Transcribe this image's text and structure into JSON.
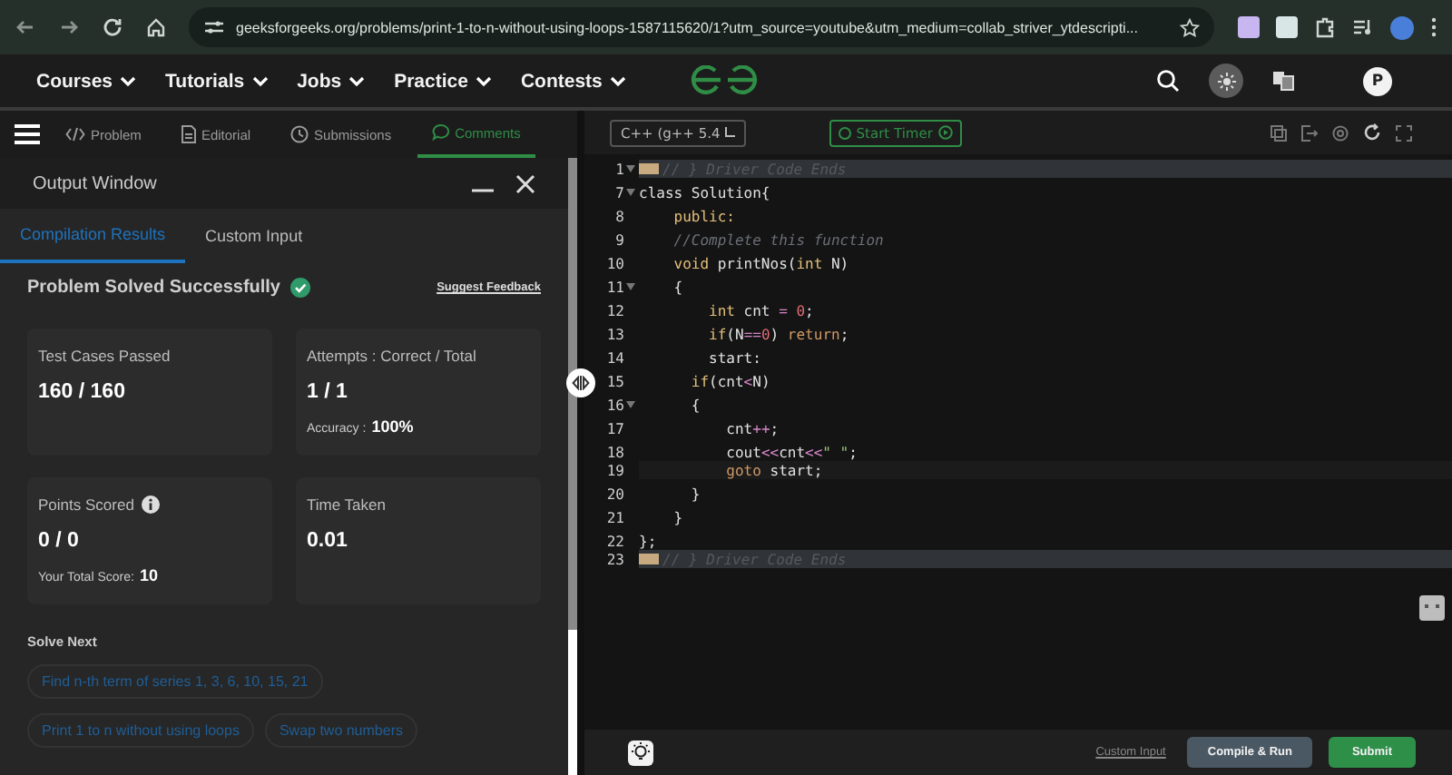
{
  "browser": {
    "url": "geeksforgeeks.org/problems/print-1-to-n-without-using-loops-1587115620/1?utm_source=youtube&utm_medium=collab_striver_ytdescripti..."
  },
  "nav": {
    "items": [
      "Courses",
      "Tutorials",
      "Jobs",
      "Practice",
      "Contests"
    ],
    "profile": "P"
  },
  "tabs": [
    {
      "label": "Problem",
      "selected": false
    },
    {
      "label": "Editorial",
      "selected": false
    },
    {
      "label": "Submissions",
      "selected": false
    },
    {
      "label": "Comments",
      "selected": true
    }
  ],
  "output": {
    "title": "Output Window",
    "tabs": [
      {
        "label": "Compilation Results",
        "selected": true
      },
      {
        "label": "Custom Input",
        "selected": false
      }
    ],
    "status": "Problem Solved Successfully",
    "feedback": "Suggest Feedback",
    "cards": [
      {
        "label": "Test Cases Passed",
        "value": "160 / 160"
      },
      {
        "label": "Attempts : Correct / Total",
        "value": "1 / 1",
        "sub_label": "Accuracy :",
        "sub_value": "100%"
      },
      {
        "label": "Points Scored",
        "value": "0 / 0",
        "info": true,
        "sub_label": "Your Total Score:",
        "sub_value": "10"
      },
      {
        "label": "Time Taken",
        "value": "0.01"
      }
    ],
    "solve_next_title": "Solve Next",
    "solve_next": [
      [
        "Find n-th term of series 1, 3, 6, 10, 15, 21"
      ],
      [
        "Print 1 to n without using loops",
        "Swap two numbers"
      ]
    ]
  },
  "editor": {
    "language": "C++ (g++ 5.4",
    "timer": "Start Timer",
    "lines": [
      {
        "n": "1",
        "fold": true,
        "kind": "folded",
        "tokens": [
          {
            "t": "// } Driver Code Ends",
            "kind": "cm"
          }
        ]
      },
      {
        "n": "7",
        "fold": true,
        "kind": "code",
        "tokens": [
          {
            "t": "class Solution{",
            "kind": "pl"
          }
        ]
      },
      {
        "n": "8",
        "fold": false,
        "kind": "code",
        "tokens": [
          {
            "t": "    public:",
            "kind": "kw"
          }
        ]
      },
      {
        "n": "9",
        "fold": false,
        "kind": "code",
        "tokens": [
          {
            "t": "    //Complete this function",
            "kind": "cm"
          }
        ]
      },
      {
        "n": "10",
        "fold": false,
        "kind": "code",
        "tokens": [
          {
            "t": "    void",
            "kind": "kw"
          },
          {
            "t": " printNos(",
            "kind": "pl"
          },
          {
            "t": "int",
            "kind": "kw"
          },
          {
            "t": " N)",
            "kind": "pl"
          }
        ]
      },
      {
        "n": "11",
        "fold": true,
        "kind": "code",
        "tokens": [
          {
            "t": "    {",
            "kind": "pl"
          }
        ]
      },
      {
        "n": "12",
        "fold": false,
        "kind": "code",
        "tokens": [
          {
            "t": "        int",
            "kind": "kw"
          },
          {
            "t": " cnt ",
            "kind": "pl"
          },
          {
            "t": "=",
            "kind": "op"
          },
          {
            "t": " 0",
            "kind": "num"
          },
          {
            "t": ";",
            "kind": "pl"
          }
        ]
      },
      {
        "n": "13",
        "fold": false,
        "kind": "code",
        "tokens": [
          {
            "t": "        if",
            "kind": "kw"
          },
          {
            "t": "(N",
            "kind": "pl"
          },
          {
            "t": "==",
            "kind": "op"
          },
          {
            "t": "0",
            "kind": "num"
          },
          {
            "t": ") ",
            "kind": "pl"
          },
          {
            "t": "return",
            "kind": "ctl"
          },
          {
            "t": ";",
            "kind": "pl"
          }
        ]
      },
      {
        "n": "14",
        "fold": false,
        "kind": "code",
        "tokens": [
          {
            "t": "        start:",
            "kind": "pl"
          }
        ]
      },
      {
        "n": "15",
        "fold": false,
        "kind": "code",
        "tokens": [
          {
            "t": "      if",
            "kind": "kw"
          },
          {
            "t": "(cnt",
            "kind": "pl"
          },
          {
            "t": "<",
            "kind": "op"
          },
          {
            "t": "N)",
            "kind": "pl"
          }
        ]
      },
      {
        "n": "16",
        "fold": true,
        "kind": "code",
        "tokens": [
          {
            "t": "      {",
            "kind": "pl"
          }
        ]
      },
      {
        "n": "17",
        "fold": false,
        "kind": "code",
        "tokens": [
          {
            "t": "          cnt",
            "kind": "pl"
          },
          {
            "t": "++",
            "kind": "op"
          },
          {
            "t": ";",
            "kind": "pl"
          }
        ]
      },
      {
        "n": "18",
        "fold": false,
        "kind": "code",
        "tokens": [
          {
            "t": "          cout",
            "kind": "pl"
          },
          {
            "t": "<<",
            "kind": "op"
          },
          {
            "t": "cnt",
            "kind": "pl"
          },
          {
            "t": "<<",
            "kind": "op"
          },
          {
            "t": "\" \"",
            "kind": "str"
          },
          {
            "t": ";",
            "kind": "pl"
          }
        ]
      },
      {
        "n": "19",
        "fold": false,
        "kind": "current",
        "tokens": [
          {
            "t": "          goto",
            "kind": "ctl"
          },
          {
            "t": " start;",
            "kind": "pl"
          }
        ]
      },
      {
        "n": "20",
        "fold": false,
        "kind": "code",
        "tokens": [
          {
            "t": "      }",
            "kind": "pl"
          }
        ]
      },
      {
        "n": "21",
        "fold": false,
        "kind": "code",
        "tokens": [
          {
            "t": "    }",
            "kind": "pl"
          }
        ]
      },
      {
        "n": "22",
        "fold": false,
        "kind": "code",
        "tokens": [
          {
            "t": "};",
            "kind": "pl"
          }
        ]
      },
      {
        "n": "23",
        "fold": false,
        "kind": "folded",
        "tokens": [
          {
            "t": "// } Driver Code Ends",
            "kind": "cm"
          }
        ]
      }
    ],
    "custom_input": "Custom Input",
    "compile": "Compile & Run",
    "submit": "Submit"
  }
}
